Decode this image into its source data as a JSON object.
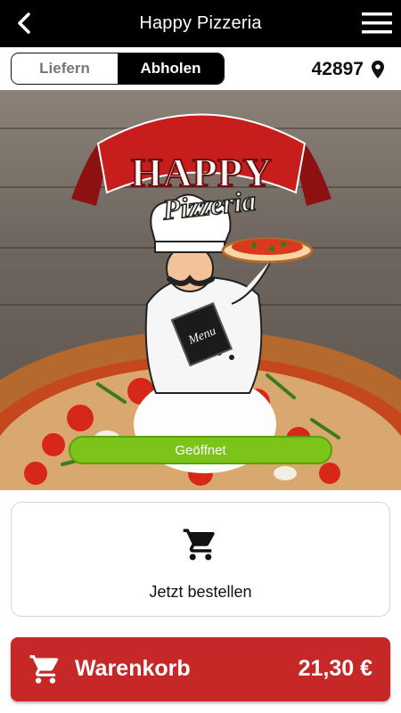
{
  "header": {
    "title": "Happy Pizzeria"
  },
  "mode": {
    "delivery_label": "Liefern",
    "pickup_label": "Abholen",
    "selected": "Abholen"
  },
  "location": {
    "zip": "42897"
  },
  "hero": {
    "logo_line1": "HAPPY",
    "logo_line2": "Pizzeria",
    "menu_board_text": "Menu",
    "status_label": "Geöffnet"
  },
  "order": {
    "label": "Jetzt bestellen"
  },
  "cart": {
    "label": "Warenkorb",
    "total": "21,30 €"
  },
  "colors": {
    "accent_red": "#c62828",
    "open_green": "#7cc41a",
    "header_bg": "#000000"
  }
}
